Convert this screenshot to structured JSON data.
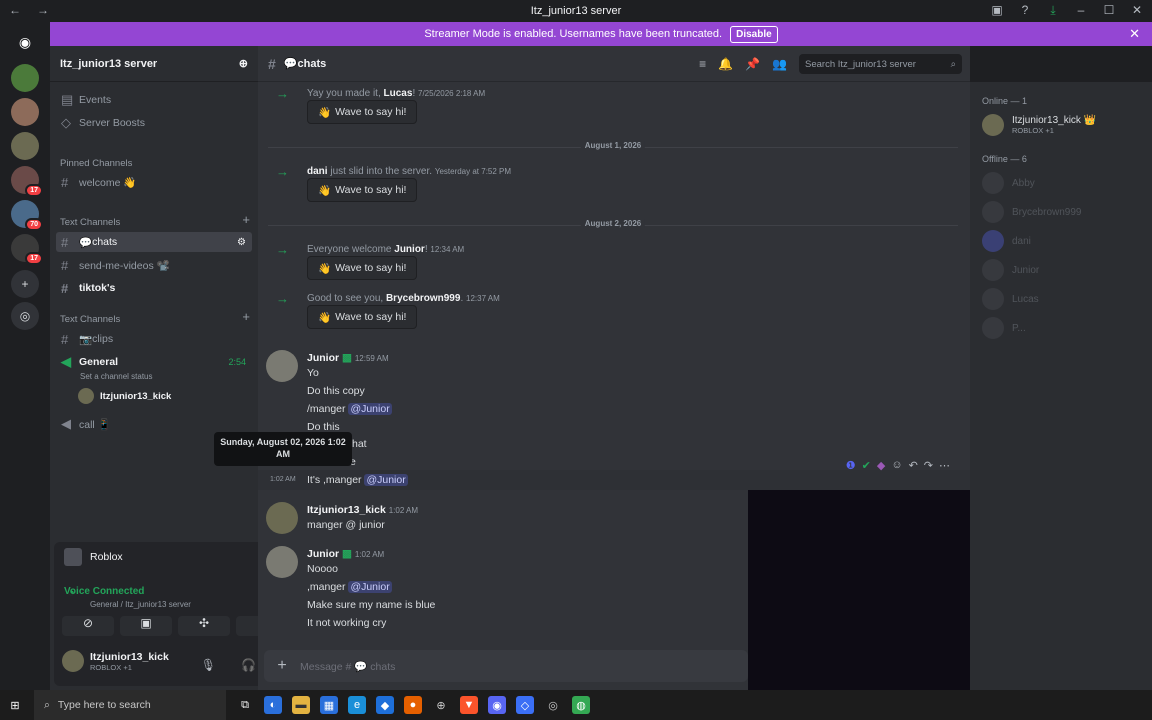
{
  "window": {
    "title": "Itz_junior13 server"
  },
  "banner": {
    "text": "Streamer Mode is enabled. Usernames have been truncated.",
    "button": "Disable"
  },
  "server": {
    "name": "Itz_junior13 server"
  },
  "sidebar": {
    "events": "Events",
    "boosts": "Server Boosts",
    "pinned_header": "Pinned Channels",
    "welcome": "welcome 👋",
    "text_header": "Text Channels",
    "chats": "chats",
    "send_me_videos": "send-me-videos 📽️",
    "tiktoks": "tiktok's",
    "text_header2": "Text Channels",
    "clips": "clips",
    "general": "General",
    "general_time": "2:54",
    "channel_status": "Set a channel status",
    "voice_user": "Itzjunior13_kick",
    "call": "call 📱"
  },
  "activity": {
    "game": "Roblox"
  },
  "voice": {
    "status": "Voice Connected",
    "channel": "General / Itz_junior13 server"
  },
  "user": {
    "name": "Itzjunior13_kick",
    "status": "ROBLOX +1"
  },
  "channel_header": {
    "name": "chats",
    "search_placeholder": "Search Itz_junior13 server"
  },
  "system_messages": [
    {
      "prefix": "Yay you made it, ",
      "user": "Lucas",
      "suffix": "!",
      "time": "7/25/2026 2:18 AM",
      "button": "Wave to say hi!"
    },
    {
      "prefix": "",
      "user": "dani",
      "suffix": " just slid into the server.",
      "time": "Yesterday at 7:52 PM",
      "button": "Wave to say hi!"
    },
    {
      "prefix": "Everyone welcome ",
      "user": "Junior",
      "suffix": "!",
      "time": "12:34 AM",
      "button": "Wave to say hi!"
    },
    {
      "prefix": "Good to see you, ",
      "user": "Brycebrown999",
      "suffix": ".",
      "time": "12:37 AM",
      "button": "Wave to say hi!"
    }
  ],
  "dividers": [
    "August 1, 2026",
    "August 2, 2026"
  ],
  "messages": {
    "m1": {
      "author": "Junior",
      "time": "12:59 AM",
      "l1": "Yo",
      "l2": "Do this copy",
      "l3a": "/manger ",
      "mention": "@Junior",
      "l4": "Do this",
      "l5": "hat",
      "l6": "e",
      "hover_time": "1:02 AM",
      "l7a": "It's ,manger "
    },
    "m2": {
      "author": "Itzjunior13_kick",
      "time": "1:02 AM",
      "l1": "manger @ junior"
    },
    "m3": {
      "author": "Junior",
      "time": "1:02 AM",
      "l1": "Noooo",
      "l2a": ",manger ",
      "mention": "@Junior",
      "l3": "Make sure my name is blue",
      "l4": "It not working cry"
    }
  },
  "tooltip": {
    "text": "Sunday, August 02, 2026 1:02 AM"
  },
  "composer": {
    "placeholder": "Message # 💬 chats"
  },
  "members": {
    "online_header": "Online — 1",
    "online": [
      {
        "name": "Itzjunior13_kick 👑",
        "status": "ROBLOX +1"
      }
    ],
    "offline_header": "Offline — 6",
    "offline": [
      "Abby",
      "Brycebrown999",
      "dani",
      "Junior",
      "Lucas",
      "P..."
    ]
  },
  "taskbar": {
    "search": "Type here to search"
  },
  "guild_badges": [
    "17",
    "70",
    "17"
  ],
  "colors": {
    "banner": "#9446d3",
    "green": "#23a55a",
    "accent": "#5865f2"
  }
}
